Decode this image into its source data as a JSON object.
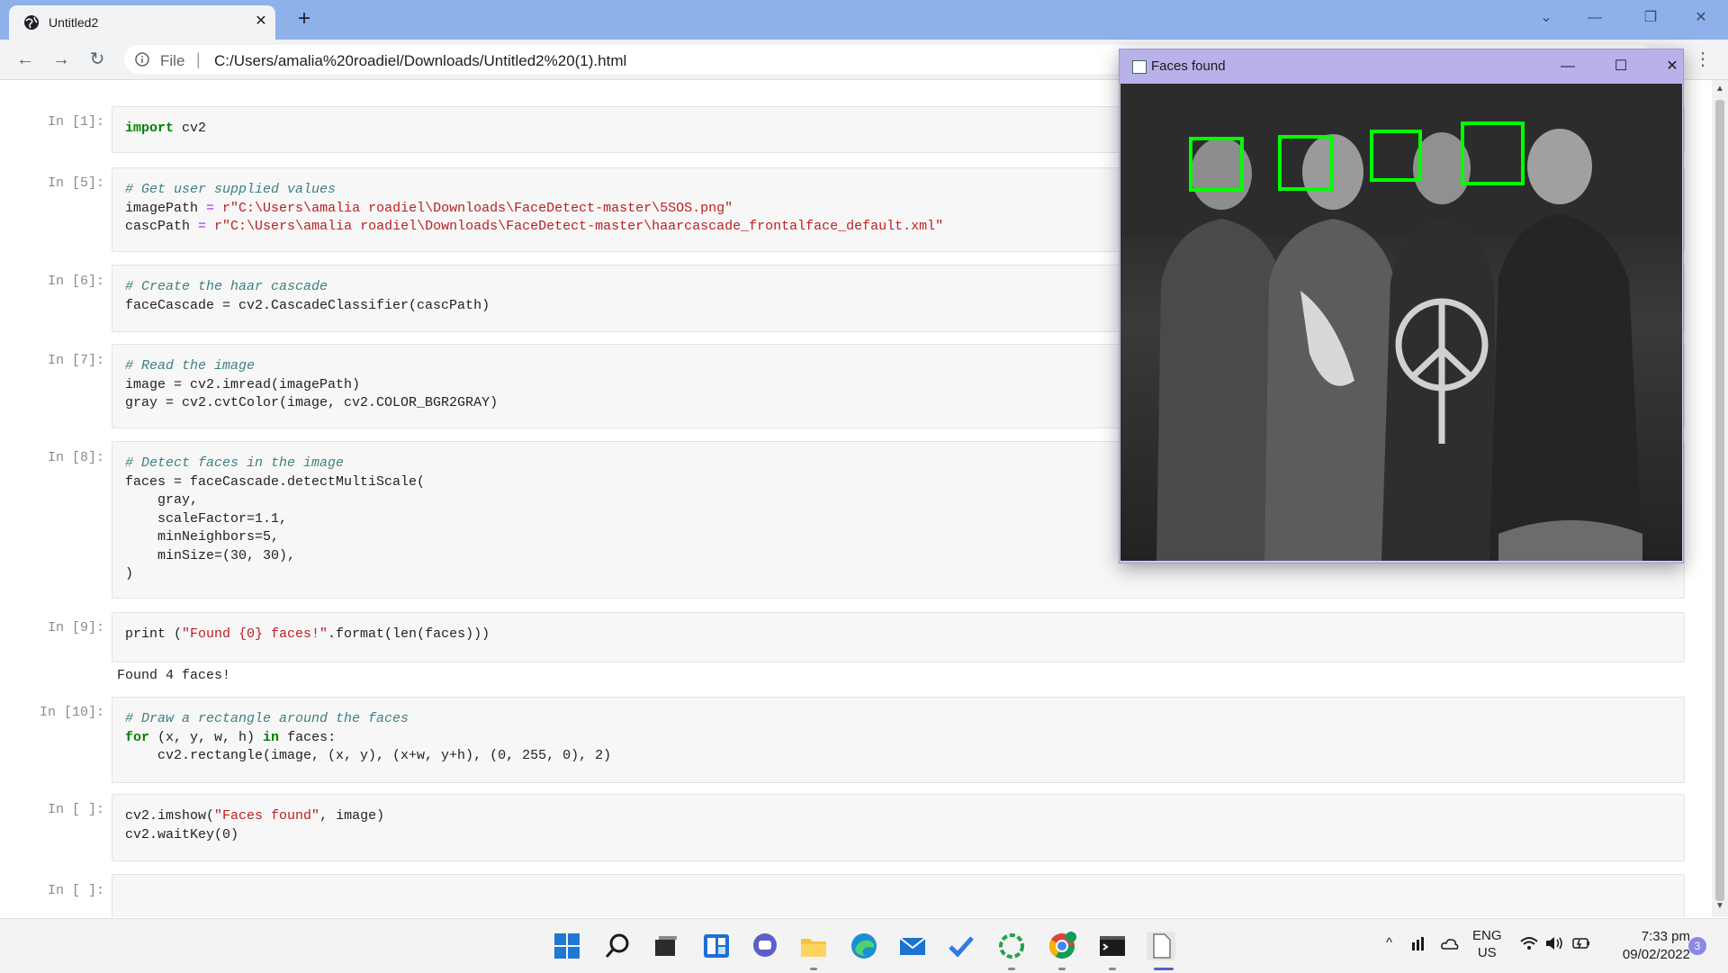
{
  "browser": {
    "tab_title": "Untitled2",
    "tab_close": "✕",
    "new_tab": "+",
    "window_controls": {
      "chevron": "⌄",
      "minimize": "—",
      "restore": "❐",
      "close": "✕"
    },
    "nav": {
      "back": "←",
      "forward": "→",
      "reload": "↻"
    },
    "url_scheme": "File",
    "url_separator": "|",
    "url": "C:/Users/amalia%20roadiel/Downloads/Untitled2%20(1).html",
    "menu": "⋮"
  },
  "notebook": {
    "cells": [
      {
        "prompt": "In [1]:"
      },
      {
        "prompt": "In [5]:"
      },
      {
        "prompt": "In [6]:"
      },
      {
        "prompt": "In [7]:"
      },
      {
        "prompt": "In [8]:"
      },
      {
        "prompt": "In [9]:",
        "output": "Found 4 faces!"
      },
      {
        "prompt": "In [10]:"
      },
      {
        "prompt": "In [ ]:"
      },
      {
        "prompt": "In [ ]:"
      }
    ],
    "code": {
      "c1_kw": "import",
      "c1_rest": " cv2",
      "c5_comment": "# Get user supplied values",
      "c5_l2_a": "imagePath ",
      "c5_l2_eq": "=",
      "c5_l2_b": " ",
      "c5_l2_str": "r\"C:\\Users\\amalia roadiel\\Downloads\\FaceDetect-master\\5SOS.png\"",
      "c5_l3_a": "cascPath ",
      "c5_l3_eq": "=",
      "c5_l3_b": " ",
      "c5_l3_str": "r\"C:\\Users\\amalia roadiel\\Downloads\\FaceDetect-master\\haarcascade_frontalface_default.xml\"",
      "c6_comment": "# Create the haar cascade",
      "c6_l2": "faceCascade = cv2.CascadeClassifier(cascPath)",
      "c7_comment": "# Read the image",
      "c7_l2": "image = cv2.imread(imagePath)",
      "c7_l3": "gray = cv2.cvtColor(image, cv2.COLOR_BGR2GRAY)",
      "c8_comment": "# Detect faces in the image",
      "c8_l2": "faces = faceCascade.detectMultiScale(",
      "c8_l3": "    gray,",
      "c8_l4": "    scaleFactor=1.1,",
      "c8_l5": "    minNeighbors=5,",
      "c8_l6": "    minSize=(30, 30),",
      "c8_l7": ")",
      "c9_a": "print (",
      "c9_str": "\"Found {0} faces!\"",
      "c9_b": ".format(len(faces)))",
      "c10_comment": "# Draw a rectangle around the faces",
      "c10_for": "for",
      "c10_mid": " (x, y, w, h) ",
      "c10_in": "in",
      "c10_end": " faces:",
      "c10_l3": "    cv2.rectangle(image, (x, y), (x+w, y+h), (0, 255, 0), 2)",
      "c11_a": "cv2.imshow(",
      "c11_str": "\"Faces found\"",
      "c11_b": ", image)",
      "c11_l2": "cv2.waitKey(0)"
    }
  },
  "face_window": {
    "title": "Faces found",
    "controls": {
      "minimize": "—",
      "maximize": "☐",
      "close": "✕"
    },
    "detection_box_color": "#00ff00",
    "faces_detected": 4
  },
  "taskbar": {
    "apps": [
      "windows-start",
      "search",
      "task-view",
      "widgets",
      "chat",
      "file-explorer",
      "edge",
      "mail",
      "todo",
      "app-green",
      "chrome",
      "terminal",
      "notepad"
    ],
    "tray": {
      "chevron": "^",
      "lang_line1": "ENG",
      "lang_line2": "US"
    },
    "time": "7:33 pm",
    "date": "09/02/2022",
    "notifications": "3"
  }
}
